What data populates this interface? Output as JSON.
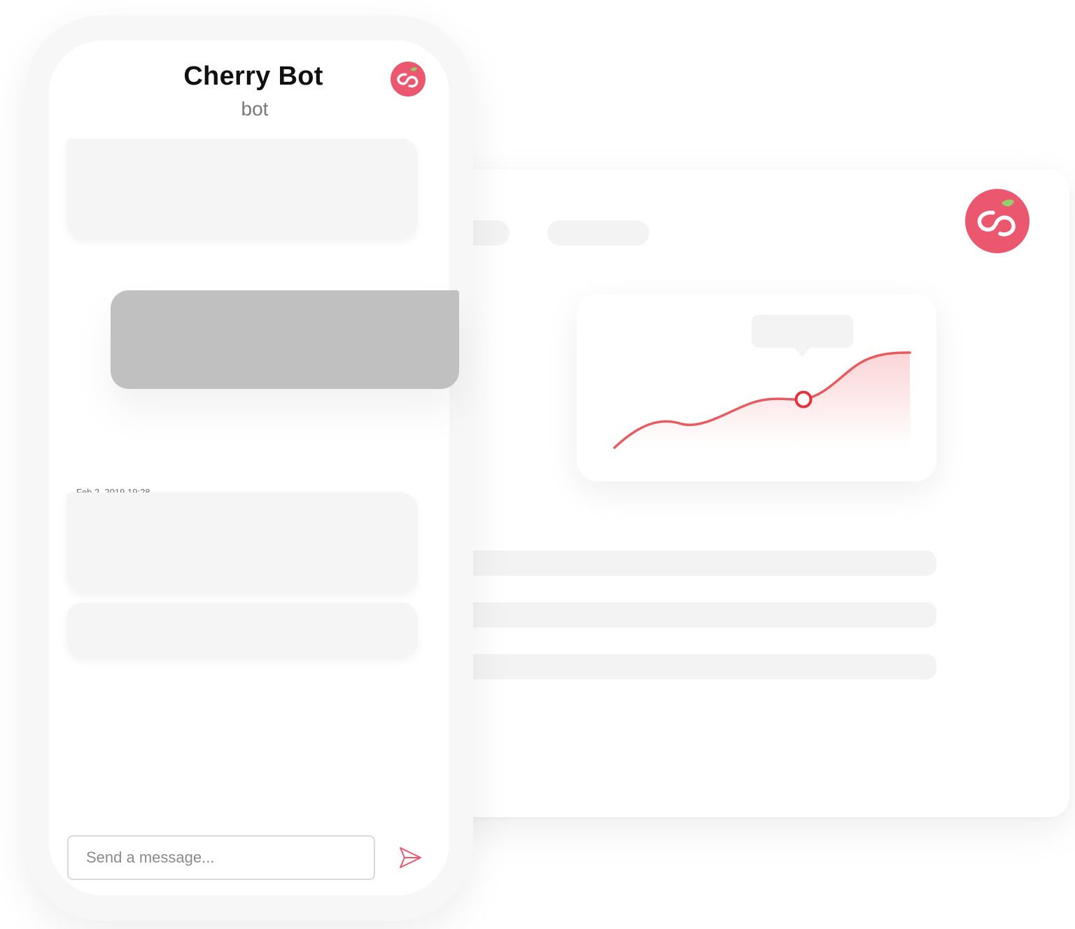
{
  "chat": {
    "title": "Cherry Bot",
    "subtitle": "bot",
    "avatar_icon": "cherry-logo-icon",
    "timestamp": "Feb 2, 2019 19:28",
    "input_placeholder": "Send a message...",
    "send_icon": "send-icon"
  },
  "dashboard": {
    "logo_icon": "cherry-logo-icon",
    "chart": {
      "type": "line",
      "highlighted_point": true,
      "has_tooltip": true
    }
  },
  "colors": {
    "brand": "#ec5770",
    "chart_line": "#e85a5e",
    "leaf": "#8fd16a",
    "user_bubble": "#c0c0c0",
    "bot_bubble": "#f5f5f5"
  }
}
